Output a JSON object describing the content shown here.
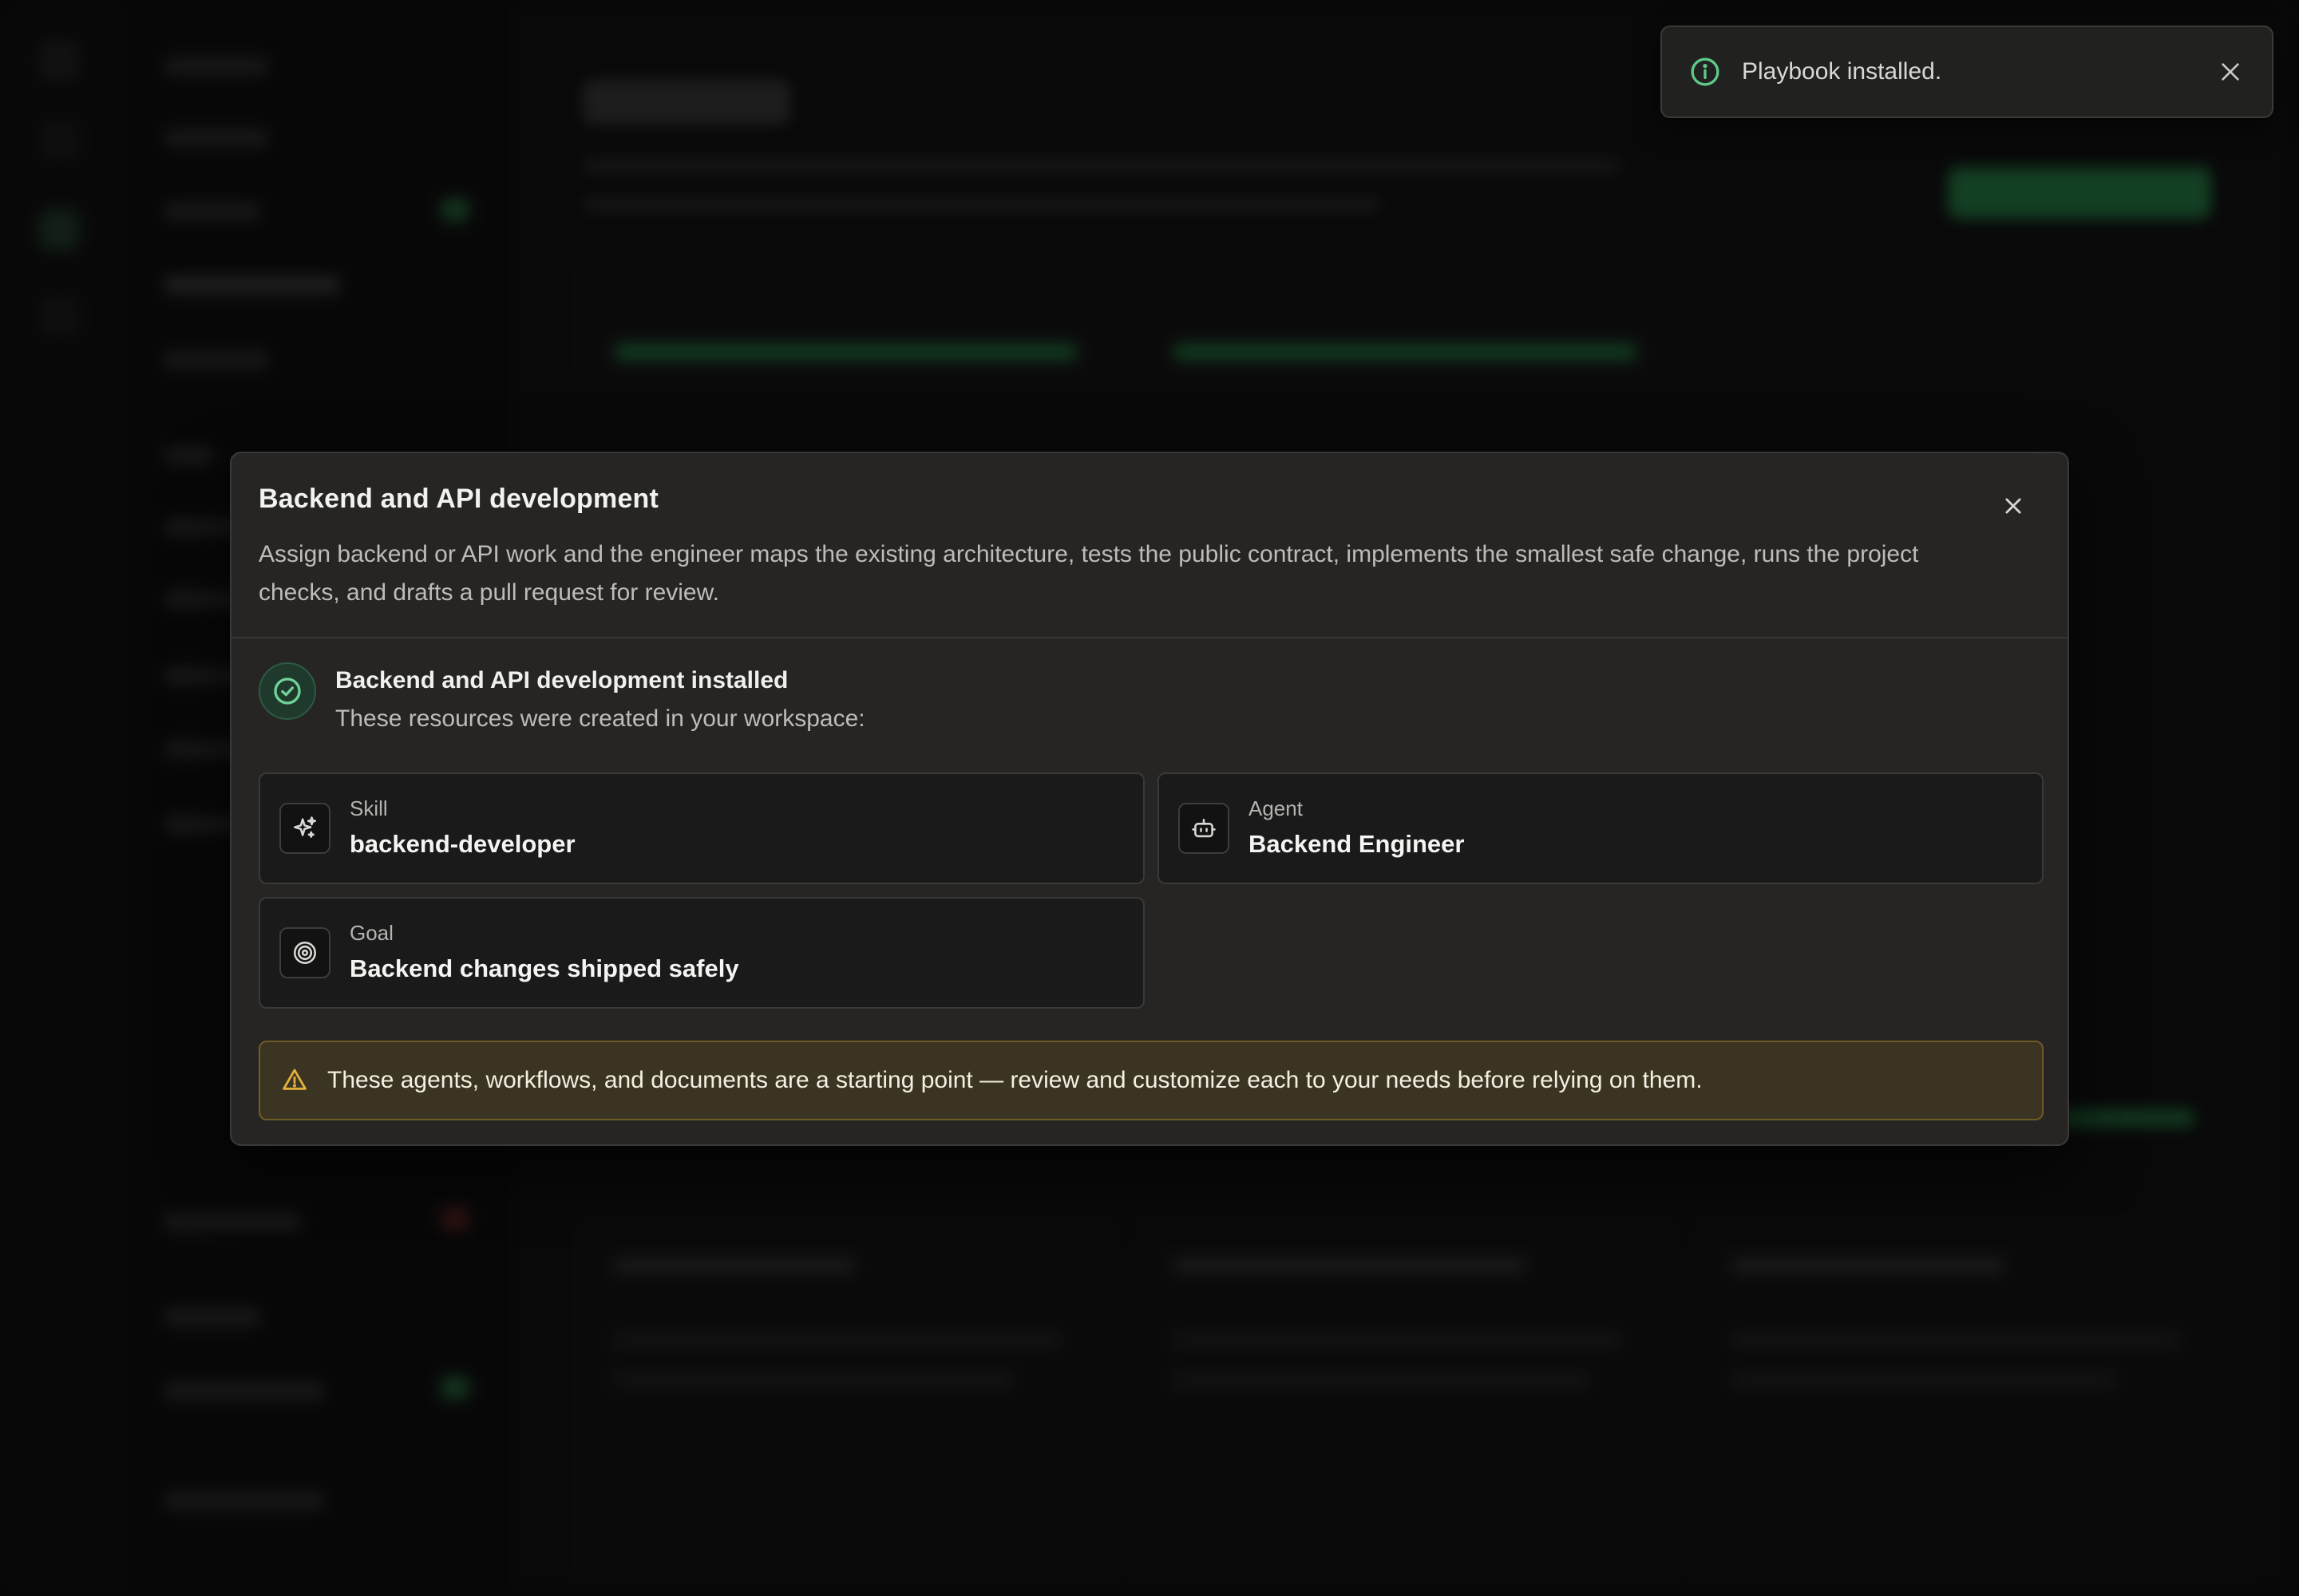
{
  "toast": {
    "message": "Playbook installed.",
    "info_icon": "info-icon",
    "close_icon": "close-icon"
  },
  "dialog": {
    "title": "Backend and API development",
    "description": "Assign backend or API work and the engineer maps the existing architecture, tests the public contract, implements the smallest safe change, runs the project checks, and drafts a pull request for review.",
    "close_icon": "close-icon",
    "installed": {
      "title": "Backend and API development installed",
      "subtitle": "These resources were created in your workspace:",
      "icon": "check-circle-icon"
    },
    "resources": [
      {
        "kind": "Skill",
        "name": "backend-developer",
        "icon": "sparkles-icon"
      },
      {
        "kind": "Agent",
        "name": "Backend Engineer",
        "icon": "bot-icon"
      },
      {
        "kind": "Goal",
        "name": "Backend changes shipped safely",
        "icon": "target-icon"
      }
    ],
    "warning": {
      "text": "These agents, workflows, and documents are a starting point — review and customize each to your needs before relying on them.",
      "icon": "warning-triangle-icon"
    }
  },
  "colors": {
    "success": "#5fc98a",
    "warning_bg": "#3b3422",
    "warning_border": "#6e5c26",
    "warning_icon": "#e2b13c",
    "surface": "#262524",
    "card": "#1a1a1a"
  }
}
